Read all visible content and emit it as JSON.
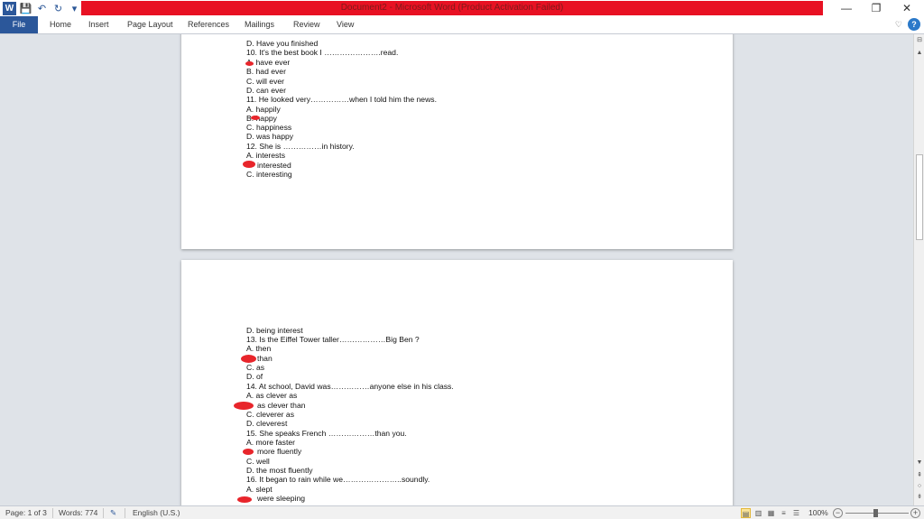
{
  "window": {
    "title": "Document2 - Microsoft Word (Product Activation Failed)",
    "controls": {
      "minimize": "—",
      "restore": "❐",
      "close": "✕"
    }
  },
  "qat": {
    "logo": "W",
    "save": "💾",
    "undo": "↶",
    "redo": "↻",
    "more": "▾"
  },
  "ribbon": {
    "tabs": [
      "File",
      "Home",
      "Insert",
      "Page Layout",
      "References",
      "Mailings",
      "Review",
      "View"
    ],
    "collapse": "♡",
    "help": "?"
  },
  "page1": {
    "lines": [
      "D. Have you finished",
      "10. It's the best book I ………………….read.",
      "A. have ever",
      "B. had ever",
      "C. will ever",
      "D. can ever",
      "11. He looked very……………when  I told him the news.",
      "A. happily",
      "B. happy",
      "C. happiness",
      "D. was happy",
      "12. She is ……………in  history.",
      "A. interests",
      "interested",
      "C. interesting"
    ]
  },
  "page2": {
    "lines": [
      "D. being interest",
      "13. Is the Eiffel Tower taller………………Big  Ben ?",
      "A. then",
      "than",
      "C. as",
      "D. of",
      "14. At school, David was……………anyone  else in his class.",
      "A. as clever as",
      "as clever than",
      "C. cleverer as",
      "D. cleverest",
      "15. She speaks French ………………than  you.",
      "A. more faster",
      "more fluently",
      "C. well",
      "D. the most fluently",
      "16. It began to rain while we…………………..soundly.",
      "A. slept",
      "were sleeping"
    ]
  },
  "status": {
    "page": "Page: 1 of 3",
    "words": "Words: 774",
    "language": "English (U.S.)",
    "zoom": "100%"
  },
  "colors": {
    "accent": "#2b579a",
    "title_bar": "#e81123",
    "answer_mark": "#e8252b"
  }
}
